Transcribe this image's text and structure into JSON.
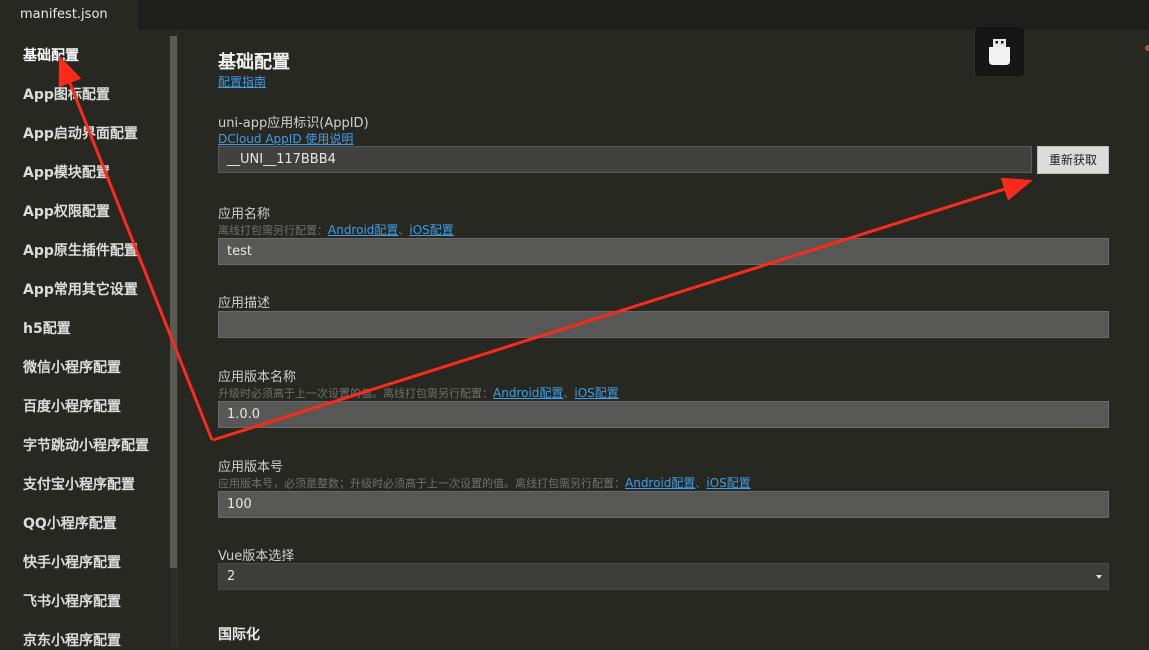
{
  "tab": {
    "label": "manifest.json"
  },
  "sidebar": {
    "items": [
      {
        "label": "基础配置"
      },
      {
        "label": "App图标配置"
      },
      {
        "label": "App启动界面配置"
      },
      {
        "label": "App模块配置"
      },
      {
        "label": "App权限配置"
      },
      {
        "label": "App原生插件配置"
      },
      {
        "label": "App常用其它设置"
      },
      {
        "label": "h5配置"
      },
      {
        "label": "微信小程序配置"
      },
      {
        "label": "百度小程序配置"
      },
      {
        "label": "字节跳动小程序配置"
      },
      {
        "label": "支付宝小程序配置"
      },
      {
        "label": "QQ小程序配置"
      },
      {
        "label": "快手小程序配置"
      },
      {
        "label": "飞书小程序配置"
      },
      {
        "label": "京东小程序配置"
      }
    ]
  },
  "main": {
    "title": "基础配置",
    "guide_link": "配置指南",
    "appid": {
      "label": "uni-app应用标识(AppID)",
      "help_link": "DCloud AppID 使用说明",
      "value": "__UNI__117BBB4",
      "button": "重新获取"
    },
    "app_name": {
      "label": "应用名称",
      "hint": "离线打包需另行配置：",
      "android_link": "Android配置",
      "sep": "、",
      "ios_link": "iOS配置",
      "value": "test"
    },
    "app_desc": {
      "label": "应用描述",
      "value": ""
    },
    "version_name": {
      "label": "应用版本名称",
      "hint": "升级时必须高于上一次设置的值。离线打包需另行配置：",
      "android_link": "Android配置",
      "sep": "、",
      "ios_link": "iOS配置",
      "value": "1.0.0"
    },
    "version_code": {
      "label": "应用版本号",
      "hint": "应用版本号，必须是整数；升级时必须高于上一次设置的值。离线打包需另行配置：",
      "android_link": "Android配置",
      "sep": "、",
      "ios_link": "iOS配置",
      "value": "100"
    },
    "vue_version": {
      "label": "Vue版本选择",
      "value": "2"
    },
    "i18n": {
      "title": "国际化"
    }
  },
  "icons": {
    "device": "usb-drive-icon",
    "dropdown": "caret-down-icon"
  },
  "colors": {
    "link": "#3e9ee8",
    "annotation_arrow": "#ff2a1a",
    "background": "#272822"
  }
}
